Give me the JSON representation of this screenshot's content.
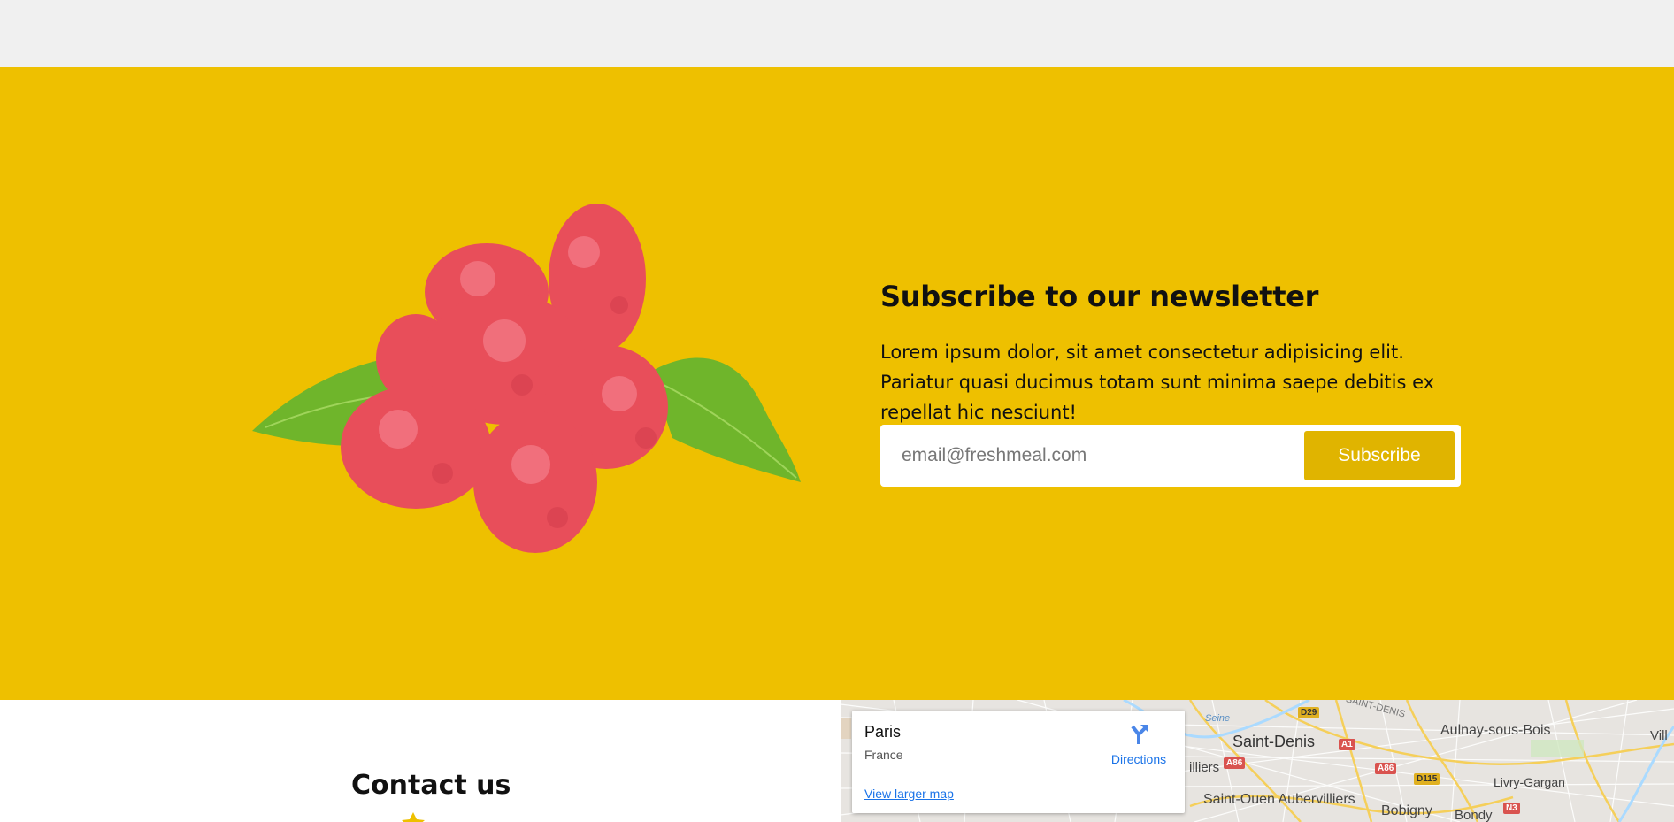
{
  "newsletter": {
    "title": "Subscribe to our newsletter",
    "body": "Lorem ipsum dolor, sit amet consectetur adipisicing elit. Pariatur quasi ducimus totam sunt minima saepe debitis ex repellat hic nesciunt!",
    "email_placeholder": "email@freshmeal.com",
    "subscribe_label": "Subscribe",
    "image_icon": "raspberries-image"
  },
  "contact": {
    "title": "Contact us"
  },
  "map": {
    "card": {
      "place": "Paris",
      "region": "France",
      "directions_label": "Directions",
      "larger_map_label": "View larger map"
    },
    "labels": {
      "saint_denis": "Saint-Denis",
      "aulnay": "Aulnay-sous-Bois",
      "aubervilliers": "Saint-Ouen Aubervilliers",
      "livry": "Livry-Gargan",
      "bobigny": "Bobigny",
      "bondy": "Bondy",
      "illiers": "illiers",
      "seine": "Seine",
      "saint_denis_river": "SAINT-DENIS",
      "vill": "Vill"
    },
    "roads": {
      "d29": "D29",
      "a1": "A1",
      "a86_1": "A86",
      "a86_2": "A86",
      "d115": "D115",
      "n3": "N3"
    }
  },
  "colors": {
    "accent": "#eec000",
    "button": "#e0b400",
    "link": "#1a73e8"
  }
}
